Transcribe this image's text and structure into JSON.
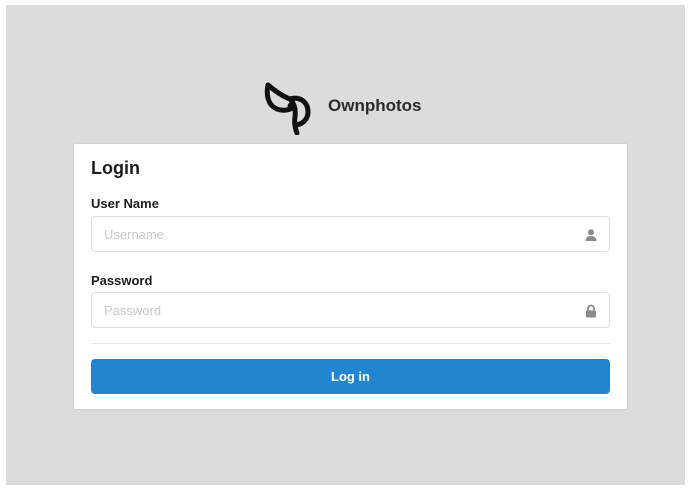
{
  "brand": {
    "name": "Ownphotos",
    "logo_icon": "ownphotos-logo-icon"
  },
  "login": {
    "title": "Login",
    "username": {
      "label": "User Name",
      "placeholder": "Username",
      "value": "",
      "icon": "user-icon"
    },
    "password": {
      "label": "Password",
      "placeholder": "Password",
      "value": "",
      "icon": "lock-icon"
    },
    "submit_label": "Log in"
  },
  "colors": {
    "background": "#dcdcdc",
    "card": "#ffffff",
    "primary_button": "#2185d0"
  }
}
